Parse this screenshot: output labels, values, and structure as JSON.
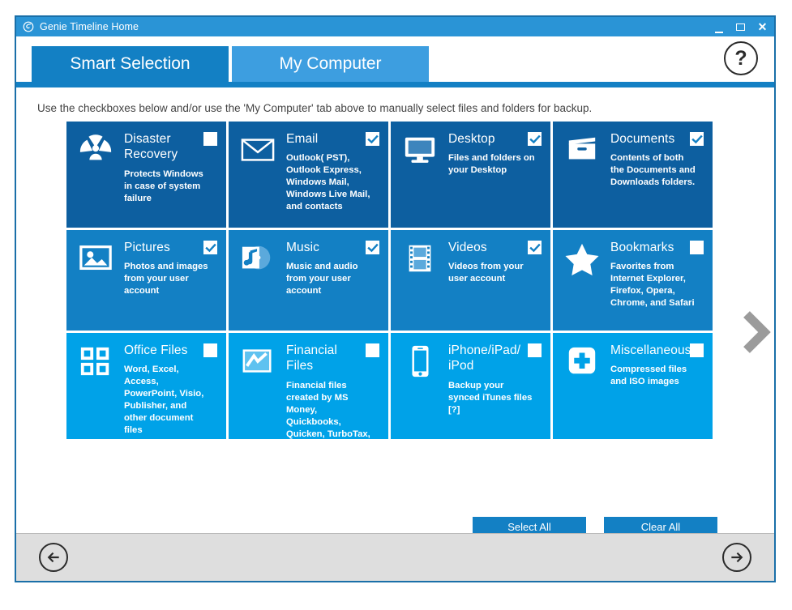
{
  "window": {
    "title": "Genie Timeline Home",
    "app_icon": "genie-swirl-icon",
    "minimize_label": "minimize",
    "maximize_label": "maximize",
    "close_label": "✕"
  },
  "tabs": [
    {
      "label": "Smart Selection",
      "active": true
    },
    {
      "label": "My Computer",
      "active": false
    }
  ],
  "help_button": {
    "label": "?"
  },
  "instructions": "Use the checkboxes below and/or use the 'My Computer' tab above to manually select files and folders for backup.",
  "tiles": [
    {
      "title": "Disaster Recovery",
      "description": "Protects Windows in case of system failure",
      "icon": "radiation-icon",
      "checked": false,
      "shade": "dark"
    },
    {
      "title": "Email",
      "description": "Outlook( PST), Outlook Express, Windows Mail, Windows Live Mail, and contacts",
      "icon": "envelope-icon",
      "checked": true,
      "shade": "dark"
    },
    {
      "title": "Desktop",
      "description": "Files and folders on your Desktop",
      "icon": "monitor-icon",
      "checked": true,
      "shade": "dark"
    },
    {
      "title": "Documents",
      "description": "Contents of both the Documents and Downloads folders.",
      "icon": "file-box-icon",
      "checked": true,
      "shade": "dark"
    },
    {
      "title": "Pictures",
      "description": "Photos and images from your user account",
      "icon": "picture-icon",
      "checked": true,
      "shade": "mid"
    },
    {
      "title": "Music",
      "description": "Music and audio from your user account",
      "icon": "music-note-icon",
      "checked": true,
      "shade": "mid"
    },
    {
      "title": "Videos",
      "description": "Videos from your user account",
      "icon": "film-strip-icon",
      "checked": true,
      "shade": "mid"
    },
    {
      "title": "Bookmarks",
      "description": "Favorites from Internet Explorer, Firefox, Opera, Chrome, and Safari",
      "icon": "star-icon",
      "checked": false,
      "shade": "mid"
    },
    {
      "title": "Office Files",
      "description": "Word, Excel, Access, PowerPoint, Visio, Publisher, and other document files",
      "icon": "office-squares-icon",
      "checked": false,
      "shade": "light"
    },
    {
      "title": "Financial Files",
      "description": "Financial files created by MS Money, Quickbooks, Quicken, TurboTax, TaxCut, and Peachtree",
      "icon": "chart-line-icon",
      "checked": false,
      "shade": "light"
    },
    {
      "title": "iPhone/iPad/ iPod",
      "description": "Backup your synced iTunes files [?]",
      "icon": "smartphone-icon",
      "checked": false,
      "shade": "light"
    },
    {
      "title": "Miscellaneous",
      "description": "Compressed files and ISO images",
      "icon": "plus-square-icon",
      "checked": false,
      "shade": "light"
    }
  ],
  "pager": {
    "next_icon": "chevron-right-icon"
  },
  "actions": {
    "select_all": "Select All",
    "clear_all": "Clear All"
  },
  "footer": {
    "back_icon": "arrow-left-circle-icon",
    "next_icon": "arrow-right-circle-icon"
  },
  "colors": {
    "titlebar": "#2a94d6",
    "tab_active": "#1380c4",
    "tab_inactive": "#3d9ee0",
    "tile_dark": "#0d5fa0",
    "tile_mid": "#1380c4",
    "tile_light": "#00a2e8",
    "footer": "#dedede",
    "window_border": "#1a6fa8"
  }
}
